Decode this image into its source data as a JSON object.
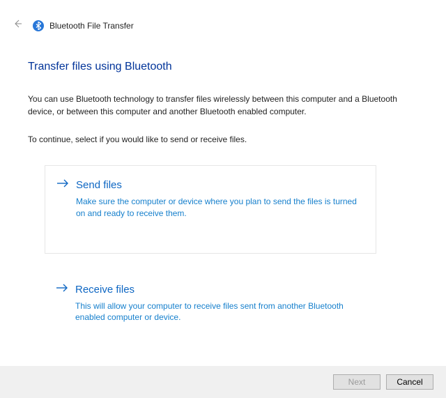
{
  "header": {
    "window_title": "Bluetooth File Transfer"
  },
  "main": {
    "page_title": "Transfer files using Bluetooth",
    "intro": "You can use Bluetooth technology to transfer files wirelessly between this computer and a Bluetooth device, or between this computer and another Bluetooth enabled computer.",
    "instruction": "To continue, select if you would like to send or receive files.",
    "options": [
      {
        "title": "Send files",
        "description": "Make sure the computer or device where you plan to send the files is turned on and ready to receive them."
      },
      {
        "title": "Receive files",
        "description": "This will allow your computer to receive files sent from another Bluetooth enabled computer or device."
      }
    ]
  },
  "footer": {
    "next_label": "Next",
    "cancel_label": "Cancel"
  }
}
